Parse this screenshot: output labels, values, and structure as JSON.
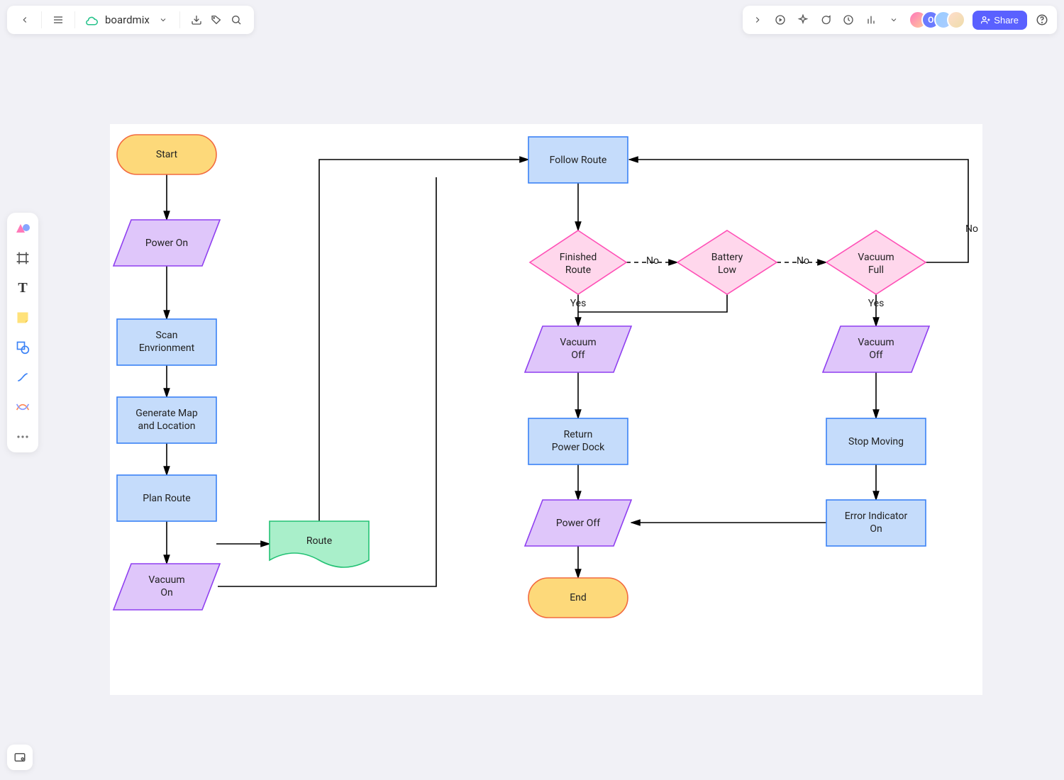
{
  "app": {
    "brand": "boardmix",
    "shareLabel": "Share",
    "avatarLetter": "O"
  },
  "nodes": {
    "start": "Start",
    "powerOn": "Power On",
    "scanEnv": "Scan\nEnvrionment",
    "genMap": "Generate Map\nand Location",
    "planRoute": "Plan Route",
    "route": "Route",
    "vacuumOn": "Vacuum\nOn",
    "followRoute": "Follow Route",
    "finishedRoute": "Finished\nRoute",
    "batteryLow": "Battery\nLow",
    "vacuumFull": "Vacuum\nFull",
    "vacuumOff1": "Vacuum\nOff",
    "vacuumOff2": "Vacuum\nOff",
    "returnDock": "Return\nPower Dock",
    "stopMoving": "Stop Moving",
    "errorInd": "Error Indicator\nOn",
    "powerOff": "Power Off",
    "end": "End"
  },
  "edgeLabels": {
    "yes": "Yes",
    "no": "No"
  },
  "colors": {
    "yellowFill": "#fdd97a",
    "yellowStroke": "#f26a3f",
    "purpleFill": "#dfc6fa",
    "purpleStroke": "#8f3ff0",
    "blueFill": "#c5dcfb",
    "blueStroke": "#3b82f6",
    "pinkFill": "#ffd7ec",
    "pinkStroke": "#ff4fb6",
    "greenFill": "#a9efca",
    "greenStroke": "#23c274"
  }
}
